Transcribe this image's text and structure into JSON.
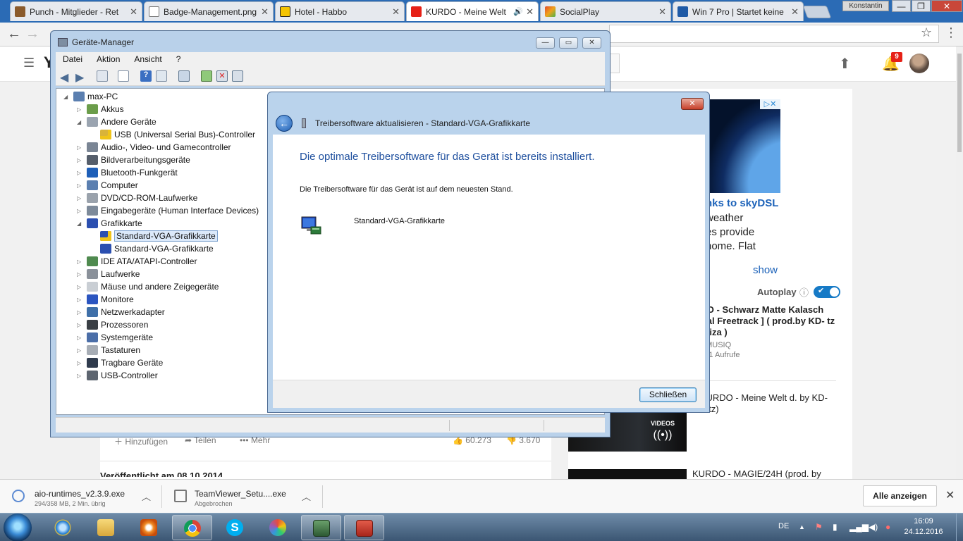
{
  "browser": {
    "tabs": [
      {
        "title": "Punch - Mitglieder - Ret",
        "favicon": "punch-icon",
        "active": false
      },
      {
        "title": "Badge-Management.png",
        "favicon": "page-icon",
        "active": false
      },
      {
        "title": "Hotel - Habbo",
        "favicon": "habbo-icon",
        "active": false
      },
      {
        "title": "KURDO - Meine Welt",
        "favicon": "youtube-icon",
        "active": true,
        "audio": true
      },
      {
        "title": "SocialPlay",
        "favicon": "socialplay-icon",
        "active": false
      },
      {
        "title": "Win 7 Pro | Startet keine",
        "favicon": "cb-icon",
        "active": false
      }
    ],
    "profile_name": "Konstantin",
    "window_buttons": {
      "minimize": "—",
      "restore": "❐",
      "close": "✕"
    },
    "nav": {
      "back": "←",
      "forward": "→",
      "bookmark": "☆",
      "menu": "⋮"
    }
  },
  "youtube": {
    "logo": "Y",
    "notifications_count": "9",
    "actions": {
      "add": "Hinzufügen",
      "share": "Teilen",
      "more": "Mehr",
      "likes": "60.273",
      "dislikes": "3.670"
    },
    "published": "Veröffentlicht am 08.10.2014",
    "ad": {
      "title": "nks to skyDSL",
      "lines": [
        "weather",
        "es provide",
        "home. Flat"
      ],
      "show": "show",
      "badge": "▷✕"
    },
    "autoplay_label": "Autoplay",
    "autoplay_on": true,
    "up_next": {
      "title": "RDO - Schwarz Matte Kalasch ficial Freetrack ] ( prod.by KD- tz & Niza )",
      "channel": "AZ MUSIQ",
      "views": "9.641 Aufrufe"
    },
    "mix": {
      "title": "– KURDO - Meine Welt d. by KD-Beatz)",
      "overlay_label": "VIDEOS",
      "overlay_icon": "((•))"
    },
    "next2": {
      "title": "KURDO - MAGIE/24H (prod. by"
    }
  },
  "device_manager": {
    "title": "Geräte-Manager",
    "menu": [
      "Datei",
      "Aktion",
      "Ansicht",
      "?"
    ],
    "tree": [
      {
        "label": "max-PC",
        "level": 0,
        "expander": "◢",
        "icon": "computer-icon"
      },
      {
        "label": "Akkus",
        "level": 1,
        "expander": "▷",
        "icon": "battery-icon"
      },
      {
        "label": "Andere Geräte",
        "level": 1,
        "expander": "◢",
        "icon": "unknown-device-icon"
      },
      {
        "label": "USB (Universal Serial Bus)-Controller",
        "level": 2,
        "expander": "",
        "icon": "warning-device-icon"
      },
      {
        "label": "Audio-, Video- und Gamecontroller",
        "level": 1,
        "expander": "▷",
        "icon": "speaker-icon"
      },
      {
        "label": "Bildverarbeitungsgeräte",
        "level": 1,
        "expander": "▷",
        "icon": "camera-icon"
      },
      {
        "label": "Bluetooth-Funkgerät",
        "level": 1,
        "expander": "▷",
        "icon": "bluetooth-icon"
      },
      {
        "label": "Computer",
        "level": 1,
        "expander": "▷",
        "icon": "computer-icon"
      },
      {
        "label": "DVD/CD-ROM-Laufwerke",
        "level": 1,
        "expander": "▷",
        "icon": "disc-drive-icon"
      },
      {
        "label": "Eingabegeräte (Human Interface Devices)",
        "level": 1,
        "expander": "▷",
        "icon": "hid-icon"
      },
      {
        "label": "Grafikkarte",
        "level": 1,
        "expander": "◢",
        "icon": "display-adapter-icon"
      },
      {
        "label": "Standard-VGA-Grafikkarte",
        "level": 2,
        "expander": "",
        "icon": "display-adapter-warning-icon",
        "selected": true
      },
      {
        "label": "Standard-VGA-Grafikkarte",
        "level": 2,
        "expander": "",
        "icon": "display-adapter-icon"
      },
      {
        "label": "IDE ATA/ATAPI-Controller",
        "level": 1,
        "expander": "▷",
        "icon": "ide-icon"
      },
      {
        "label": "Laufwerke",
        "level": 1,
        "expander": "▷",
        "icon": "disk-drive-icon"
      },
      {
        "label": "Mäuse und andere Zeigegeräte",
        "level": 1,
        "expander": "▷",
        "icon": "mouse-icon"
      },
      {
        "label": "Monitore",
        "level": 1,
        "expander": "▷",
        "icon": "monitor-icon"
      },
      {
        "label": "Netzwerkadapter",
        "level": 1,
        "expander": "▷",
        "icon": "network-icon"
      },
      {
        "label": "Prozessoren",
        "level": 1,
        "expander": "▷",
        "icon": "processor-icon"
      },
      {
        "label": "Systemgeräte",
        "level": 1,
        "expander": "▷",
        "icon": "system-device-icon"
      },
      {
        "label": "Tastaturen",
        "level": 1,
        "expander": "▷",
        "icon": "keyboard-icon"
      },
      {
        "label": "Tragbare Geräte",
        "level": 1,
        "expander": "▷",
        "icon": "portable-device-icon"
      },
      {
        "label": "USB-Controller",
        "level": 1,
        "expander": "▷",
        "icon": "usb-icon"
      }
    ],
    "caption_buttons": {
      "minimize": "—",
      "maximize": "▭",
      "close": "✕"
    }
  },
  "driver_dialog": {
    "title": "Treibersoftware aktualisieren - Standard-VGA-Grafikkarte",
    "heading": "Die optimale Treibersoftware für das Gerät ist bereits installiert.",
    "text": "Die Treibersoftware für das Gerät ist auf dem neuesten Stand.",
    "device_name": "Standard-VGA-Grafikkarte",
    "close_button": "Schließen",
    "back_glyph": "←",
    "close_glyph": "✕"
  },
  "downloads": [
    {
      "name": "aio-runtimes_v2.3.9.exe",
      "status": "294/358 MB, 2 Min. übrig"
    },
    {
      "name": "TeamViewer_Setu....exe",
      "status": "Abgebrochen"
    }
  ],
  "downloads_show_all": "Alle anzeigen",
  "downloads_close": "✕",
  "taskbar": {
    "apps": [
      "ie-icon",
      "explorer-icon",
      "media-player-icon",
      "chrome-icon",
      "skype-icon",
      "paint-icon",
      "device-manager-icon",
      "toolbox-icon"
    ],
    "language": "DE",
    "tray_up": "▲",
    "time": "16:09",
    "date": "24.12.2016"
  },
  "colors": {
    "dialog_heading": "#1e4f9e",
    "youtube_red": "#e62117",
    "link_blue": "#1c62b9",
    "selection": "#dbe9fa"
  }
}
